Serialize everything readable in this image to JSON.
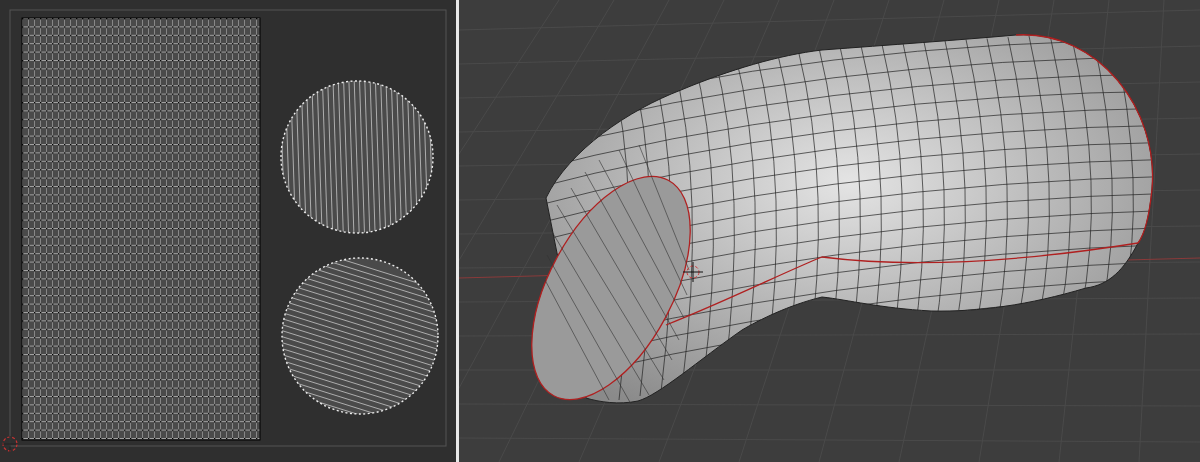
{
  "editors": [
    {
      "kind": "uv_editor"
    },
    {
      "kind": "viewport"
    }
  ]
}
